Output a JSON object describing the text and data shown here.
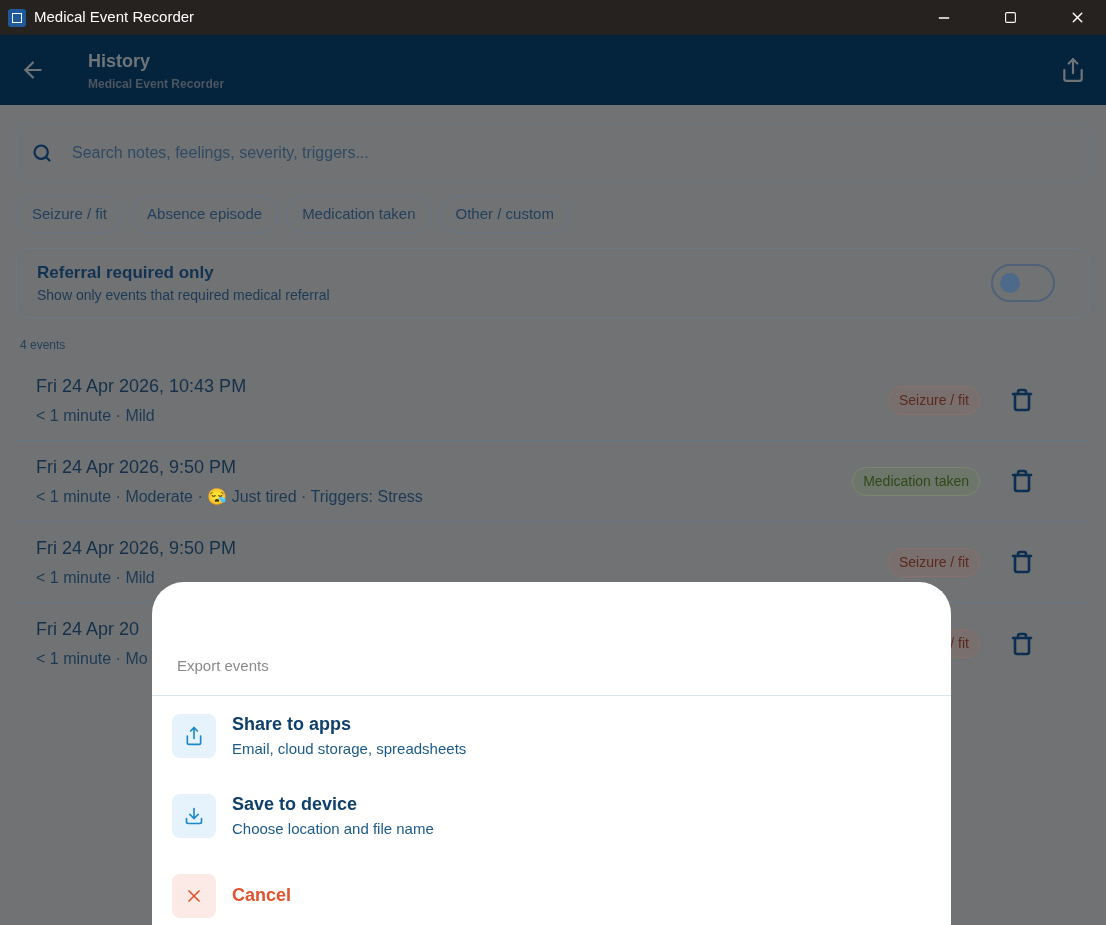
{
  "window": {
    "title": "Medical Event Recorder"
  },
  "header": {
    "title": "History",
    "subtitle": "Medical Event Recorder"
  },
  "search": {
    "placeholder": "Search notes, feelings, severity, triggers..."
  },
  "filters": [
    {
      "label": "Seizure / fit",
      "selected": false
    },
    {
      "label": "Absence episode",
      "selected": false
    },
    {
      "label": "Medication taken",
      "selected": false
    },
    {
      "label": "Other / custom",
      "selected": false
    }
  ],
  "referral_toggle": {
    "title": "Referral required only",
    "description": "Show only events that required medical referral",
    "on": false
  },
  "count": "4 events",
  "events": [
    {
      "date": "Fri 24 Apr 2026, 10:43 PM",
      "details": "< 1 minute · Mild",
      "tag": "Seizure / fit",
      "kind": "seizure"
    },
    {
      "date": "Fri 24 Apr 2026, 9:50 PM",
      "details": "< 1 minute · Moderate · 😪 Just tired · Triggers: Stress",
      "tag": "Medication taken",
      "kind": "medication"
    },
    {
      "date": "Fri 24 Apr 2026, 9:50 PM",
      "details": "< 1 minute · Mild",
      "tag": "Seizure / fit",
      "kind": "seizure"
    },
    {
      "date": "Fri 24 Apr 20",
      "details": "< 1 minute · Mo",
      "tag": "/ fit",
      "kind": "seizure"
    }
  ],
  "sheet": {
    "title": "Export events",
    "options": [
      {
        "kind": "share",
        "label": "Share to apps",
        "description": "Email, cloud storage, spreadsheets"
      },
      {
        "kind": "save",
        "label": "Save to device",
        "description": "Choose location and file name"
      },
      {
        "kind": "cancel",
        "label": "Cancel"
      }
    ]
  }
}
